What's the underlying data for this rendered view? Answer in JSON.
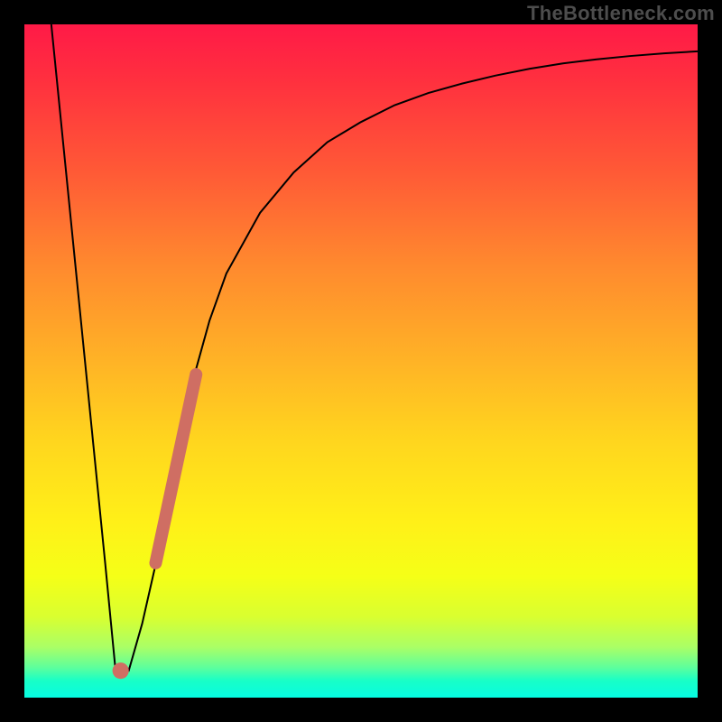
{
  "watermark": "TheBottleneck.com",
  "chart_data": {
    "type": "line",
    "title": "",
    "xlabel": "",
    "ylabel": "",
    "xlim": [
      0,
      100
    ],
    "ylim": [
      0,
      100
    ],
    "grid": false,
    "series": [
      {
        "name": "curve",
        "color": "#000000",
        "stroke_width": 2,
        "x": [
          4,
          6,
          8,
          10,
          12,
          13.5,
          15.5,
          17.5,
          20,
          22.5,
          25,
          27.5,
          30,
          35,
          40,
          45,
          50,
          55,
          60,
          65,
          70,
          75,
          80,
          85,
          90,
          95,
          100
        ],
        "y": [
          100,
          80,
          60,
          40,
          20,
          4.5,
          4,
          11,
          22,
          35,
          47,
          56,
          63,
          72,
          78,
          82.5,
          85.5,
          88,
          89.8,
          91.2,
          92.4,
          93.4,
          94.2,
          94.8,
          95.3,
          95.7,
          96
        ]
      },
      {
        "name": "highlight-segment",
        "color": "#cf6e63",
        "stroke_width": 14,
        "linecap": "round",
        "x": [
          19.5,
          25.5
        ],
        "y": [
          20,
          48
        ]
      },
      {
        "name": "marker-dot",
        "color": "#cf6e63",
        "type_hint": "marker",
        "x": [
          14.3
        ],
        "y": [
          4.0
        ],
        "size": 10
      }
    ],
    "background_gradient": {
      "direction": "vertical",
      "stops": [
        {
          "pos": 0.0,
          "color": "#ff1a47"
        },
        {
          "pos": 0.5,
          "color": "#ffb326"
        },
        {
          "pos": 0.82,
          "color": "#f5ff17"
        },
        {
          "pos": 1.0,
          "color": "#06fbe2"
        }
      ]
    }
  }
}
